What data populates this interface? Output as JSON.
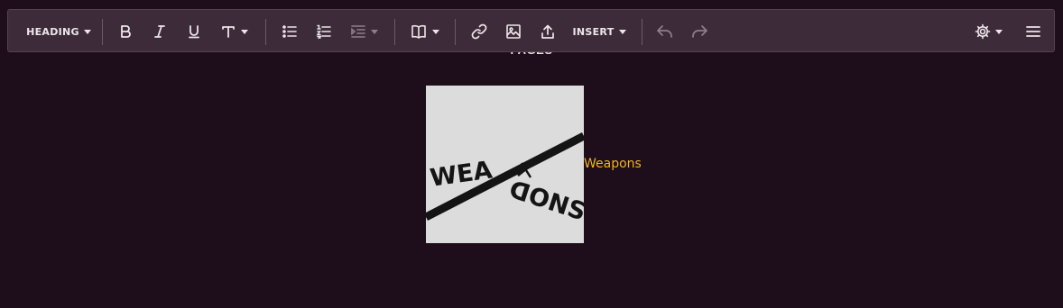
{
  "toolbar": {
    "heading_label": "HEADING",
    "insert_label": "INSERT",
    "icons": [
      "bold-icon",
      "italic-icon",
      "underline-icon",
      "text-size-icon",
      "bullet-list-icon",
      "numbered-list-icon",
      "indent-icon",
      "book-icon",
      "link-icon",
      "image-icon",
      "upload-icon",
      "undo-icon",
      "redo-icon",
      "settings-icon",
      "menu-icon"
    ]
  },
  "content": {
    "section_heading": "PAGES",
    "figure": {
      "logo_text": "WEAPONS",
      "link_text": "Weapons"
    }
  },
  "colors": {
    "background": "#1e0d1a",
    "toolbar": "#3e2b39",
    "link": "#f2b321"
  }
}
